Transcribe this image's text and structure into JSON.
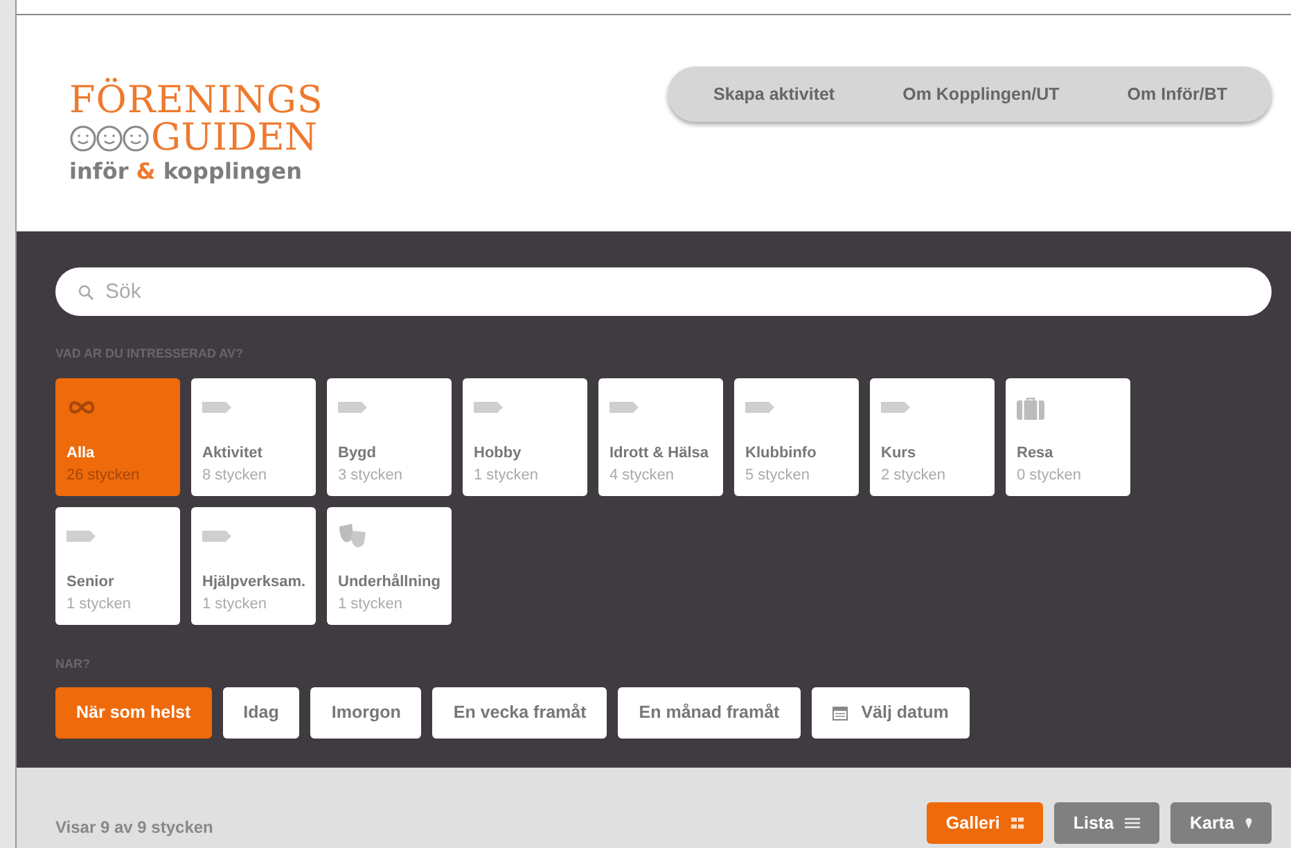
{
  "logo": {
    "line_1": "FÖRENINGS",
    "line_2": "GUIDEN",
    "line_3": [
      "inför",
      "&",
      "kopplingen"
    ]
  },
  "nav": [
    "Skapa aktivitet",
    "Om Kopplingen/UT",
    "Om Inför/BT"
  ],
  "search": {
    "placeholder": "Sök"
  },
  "interest": {
    "heading": "VAD AR DU INTRESSERAD AV?",
    "tiles": [
      {
        "kind": "all",
        "label": "Alla",
        "count": "26 stycken",
        "selected": true
      },
      {
        "kind": "tag",
        "label": "Aktivitet",
        "count": "8 stycken",
        "selected": false
      },
      {
        "kind": "tag",
        "label": "Bygd",
        "count": "3 stycken",
        "selected": false
      },
      {
        "kind": "tag",
        "label": "Hobby",
        "count": "1 stycken",
        "selected": false
      },
      {
        "kind": "tag",
        "label": "Idrott & Hälsa",
        "count": "4 stycken",
        "selected": false
      },
      {
        "kind": "tag",
        "label": "Klubbinfo",
        "count": "5 stycken",
        "selected": false
      },
      {
        "kind": "tag",
        "label": "Kurs",
        "count": "2 stycken",
        "selected": false
      },
      {
        "kind": "travel",
        "label": "Resa",
        "count": "0 stycken",
        "selected": false
      },
      {
        "kind": "tag",
        "label": "Senior",
        "count": "1 stycken",
        "selected": false
      },
      {
        "kind": "tag",
        "label": "Hjälpverksam.",
        "count": "1 stycken",
        "selected": false
      },
      {
        "kind": "theater",
        "label": "Underhållning",
        "count": "1 stycken",
        "selected": false
      }
    ]
  },
  "when": {
    "heading": "NAR?",
    "options": [
      {
        "label": "När som helst",
        "selected": true,
        "calendar": false
      },
      {
        "label": "Idag",
        "selected": false,
        "calendar": false
      },
      {
        "label": "Imorgon",
        "selected": false,
        "calendar": false
      },
      {
        "label": "En vecka framåt",
        "selected": false,
        "calendar": false
      },
      {
        "label": "En månad framåt",
        "selected": false,
        "calendar": false
      },
      {
        "label": "Välj datum",
        "selected": false,
        "calendar": true
      }
    ]
  },
  "results": {
    "summary": "Visar 9 av 9 stycken",
    "views": [
      {
        "kind": "gallery",
        "label": "Galleri",
        "selected": true
      },
      {
        "kind": "list",
        "label": "Lista",
        "selected": false
      },
      {
        "kind": "map",
        "label": "Karta",
        "selected": false
      }
    ]
  }
}
